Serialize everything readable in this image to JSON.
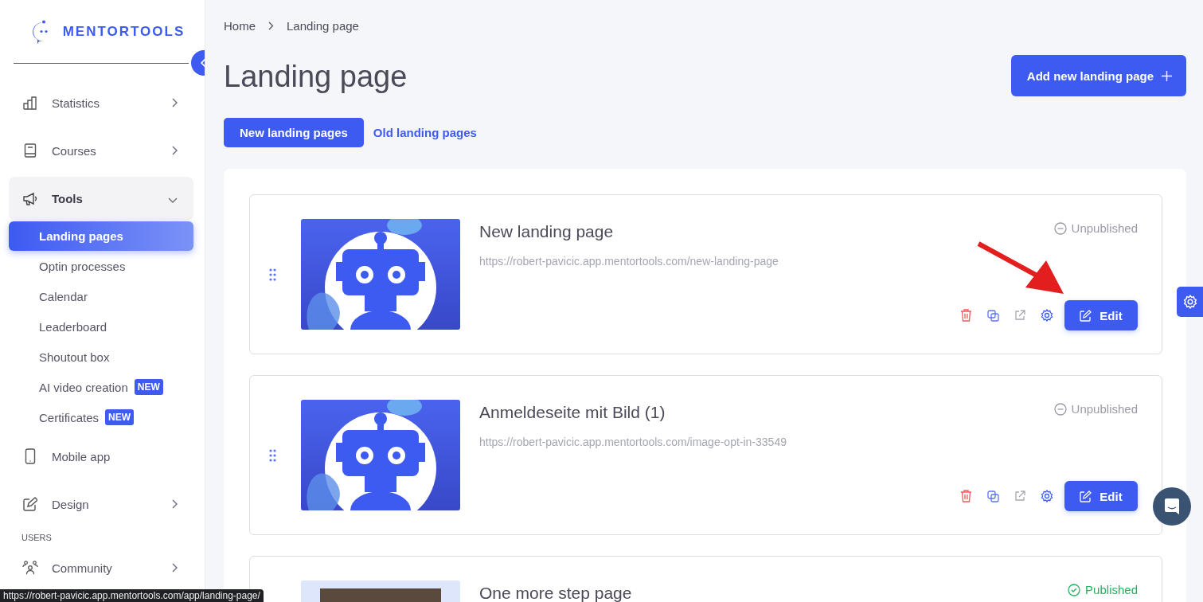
{
  "logo": {
    "text": "MENTORTOOLS"
  },
  "sidebar": {
    "items": [
      {
        "kind": "main",
        "label": "Statistics",
        "expanded": false
      },
      {
        "kind": "main",
        "label": "Courses",
        "expanded": false
      },
      {
        "kind": "main",
        "label": "Tools",
        "expanded": true,
        "children": [
          {
            "label": "Landing pages",
            "selected": true
          },
          {
            "label": "Optin processes",
            "selected": false
          },
          {
            "label": "Calendar",
            "selected": false
          },
          {
            "label": "Leaderboard",
            "selected": false
          },
          {
            "label": "Shoutout box",
            "selected": false
          },
          {
            "label": "AI video creation",
            "selected": false,
            "badge": "NEW"
          },
          {
            "label": "Certificates",
            "selected": false,
            "badge": "NEW"
          }
        ]
      },
      {
        "kind": "plain",
        "label": "Mobile app"
      },
      {
        "kind": "main",
        "label": "Design",
        "expanded": false
      },
      {
        "kind": "section",
        "label": "USERS"
      },
      {
        "kind": "main",
        "label": "Community",
        "expanded": false
      }
    ]
  },
  "breadcrumb": [
    "Home",
    "Landing page"
  ],
  "title": "Landing page",
  "add_button": "Add new landing page",
  "tabs": [
    {
      "label": "New landing pages",
      "selected": true
    },
    {
      "label": "Old landing pages",
      "selected": false
    }
  ],
  "cards": [
    {
      "title": "New landing page",
      "url": "https://robert-pavicic.app.mentortools.com/new-landing-page",
      "thumbnail": {
        "kind": "robot"
      },
      "status": {
        "kind": "unpublished",
        "label": "Unpublished"
      },
      "edit_label": "Edit"
    },
    {
      "title": "Anmeldeseite mit Bild (1)",
      "url": "https://robert-pavicic.app.mentortools.com/image-opt-in-33549",
      "thumbnail": {
        "kind": "robot"
      },
      "status": {
        "kind": "unpublished",
        "label": "Unpublished"
      },
      "edit_label": "Edit"
    },
    {
      "title": "One more step page",
      "thumbnail": {
        "kind": "photo"
      },
      "status": {
        "kind": "published",
        "label": "Published"
      }
    }
  ],
  "status_url": "https://robert-pavicic.app.mentortools.com/app/landing-page/"
}
